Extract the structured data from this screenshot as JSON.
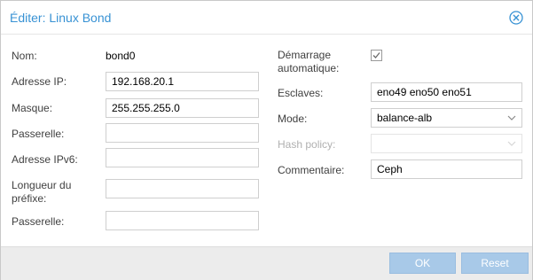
{
  "dialog": {
    "title": "Éditer: Linux Bond"
  },
  "left": {
    "name_label": "Nom:",
    "name_value": "bond0",
    "ip_label": "Adresse IP:",
    "ip_value": "192.168.20.1",
    "mask_label": "Masque:",
    "mask_value": "255.255.255.0",
    "gateway_label": "Passerelle:",
    "gateway_value": "",
    "ipv6_label": "Adresse IPv6:",
    "ipv6_value": "",
    "prefix_label_line1": "Longueur du",
    "prefix_label_line2": "préfixe:",
    "prefix_value": "",
    "gateway6_label": "Passerelle:",
    "gateway6_value": ""
  },
  "right": {
    "autostart_label_line1": "Démarrage",
    "autostart_label_line2": "automatique:",
    "autostart_checked": true,
    "slaves_label": "Esclaves:",
    "slaves_value": "eno49 eno50 eno51",
    "mode_label": "Mode:",
    "mode_value": "balance-alb",
    "hash_label": "Hash policy:",
    "hash_value": "",
    "comment_label": "Commentaire:",
    "comment_value": "Ceph"
  },
  "footer": {
    "ok_label": "OK",
    "reset_label": "Reset"
  },
  "icons": {
    "close": "close-circle-icon",
    "checkmark": "checkmark-icon",
    "chevron": "chevron-down-icon"
  },
  "colors": {
    "title": "#3892d4",
    "button_disabled": "#a8c9e8",
    "footer_bg": "#ececec"
  }
}
